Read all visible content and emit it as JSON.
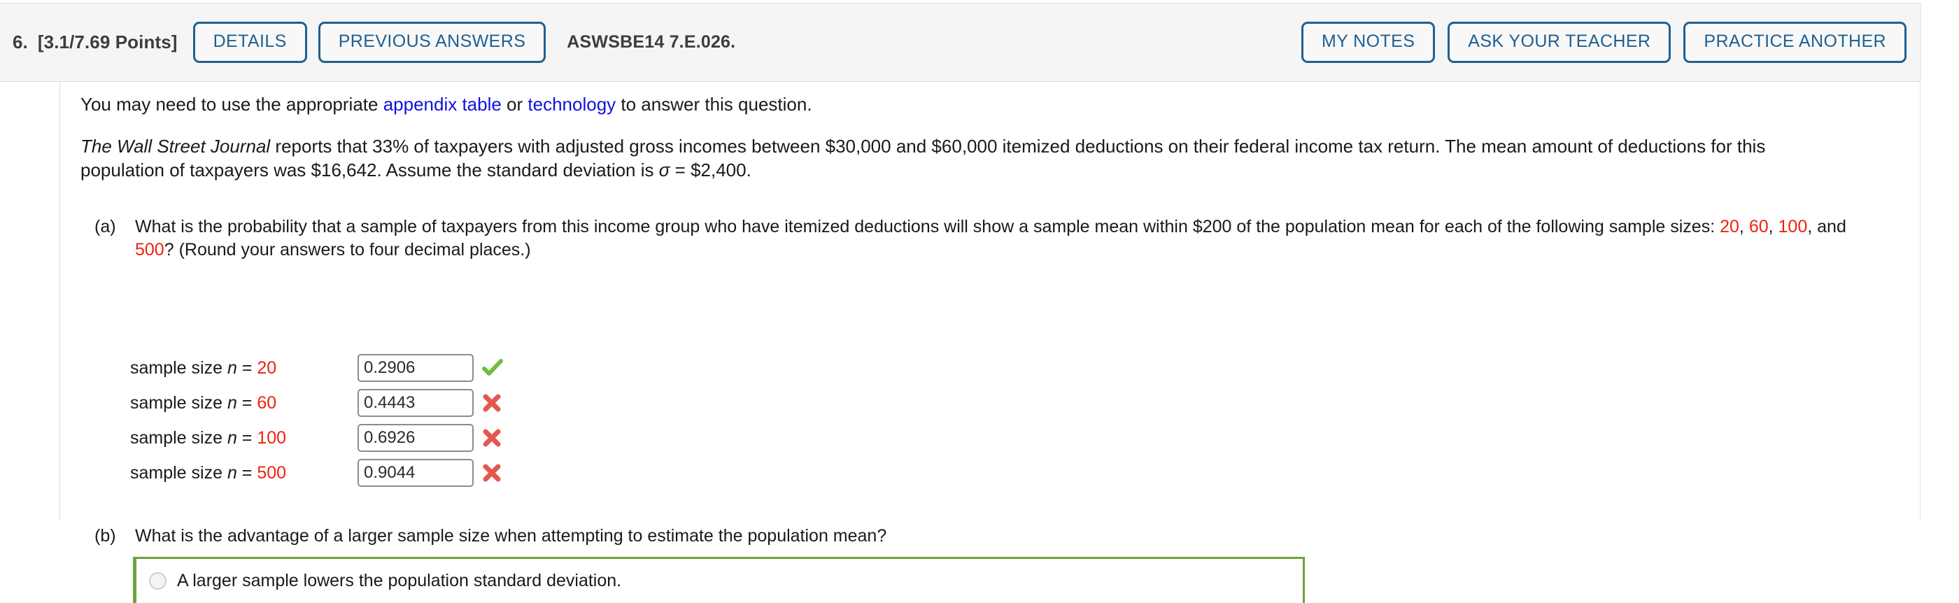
{
  "header": {
    "question_number": "6.",
    "points": "[3.1/7.69 Points]",
    "question_code": "ASWSBE14 7.E.026.",
    "buttons_left": [
      {
        "label": "DETAILS",
        "name": "details-button"
      },
      {
        "label": "PREVIOUS ANSWERS",
        "name": "previous-answers-button"
      }
    ],
    "buttons_right": [
      {
        "label": "MY NOTES",
        "name": "my-notes-button"
      },
      {
        "label": "ASK YOUR TEACHER",
        "name": "ask-your-teacher-button"
      },
      {
        "label": "PRACTICE ANOTHER",
        "name": "practice-another-button"
      }
    ]
  },
  "intro": {
    "text_before": "You may need to use the appropriate ",
    "link_1": "appendix table",
    "text_middle": " or ",
    "link_2": "technology",
    "text_after": " to answer this question."
  },
  "problem": {
    "source_italic": "The Wall Street Journal",
    "body": " reports that 33% of taxpayers with adjusted gross incomes between $30,000 and $60,000 itemized deductions on their federal income tax return. The mean amount of deductions for this population of taxpayers was $16,642. Assume the standard deviation is ",
    "sigma": "σ",
    "sigma_value": " = $2,400."
  },
  "parts": {
    "a": {
      "label": "(a)",
      "text_1": "What is the probability that a sample of taxpayers from this income group who have itemized deductions will show a sample mean within $200 of the population mean for each of the following sample sizes: ",
      "sizes": [
        "20",
        "60",
        "100",
        "500"
      ],
      "text_2": "? (Round your answers to four decimal places.)"
    },
    "b": {
      "label": "(b)",
      "text": "What is the advantage of a larger sample size when attempting to estimate the population mean?",
      "choices": [
        {
          "label": "A larger sample lowers the population standard deviation.",
          "selected": false
        }
      ]
    }
  },
  "answer_rows": [
    {
      "prefix": "sample size ",
      "var": "n",
      "eq": " = ",
      "n": "20",
      "value": "0.2906",
      "status": "correct",
      "status_icon": "green-check-icon"
    },
    {
      "prefix": "sample size ",
      "var": "n",
      "eq": " = ",
      "n": "60",
      "value": "0.4443",
      "status": "incorrect",
      "status_icon": "red-x-icon"
    },
    {
      "prefix": "sample size ",
      "var": "n",
      "eq": " = ",
      "n": "100",
      "value": "0.6926",
      "status": "incorrect",
      "status_icon": "red-x-icon"
    },
    {
      "prefix": "sample size ",
      "var": "n",
      "eq": " = ",
      "n": "500",
      "value": "0.9044",
      "status": "incorrect",
      "status_icon": "red-x-icon"
    }
  ],
  "colors": {
    "button_blue": "#1f6091",
    "link_blue": "#1111e0",
    "highlight_red": "#ee2211",
    "correct_green": "#76bb3f",
    "incorrect_red": "#e4584f",
    "choice_border_green": "#6ca43c",
    "header_bg": "#f5f5f5"
  }
}
